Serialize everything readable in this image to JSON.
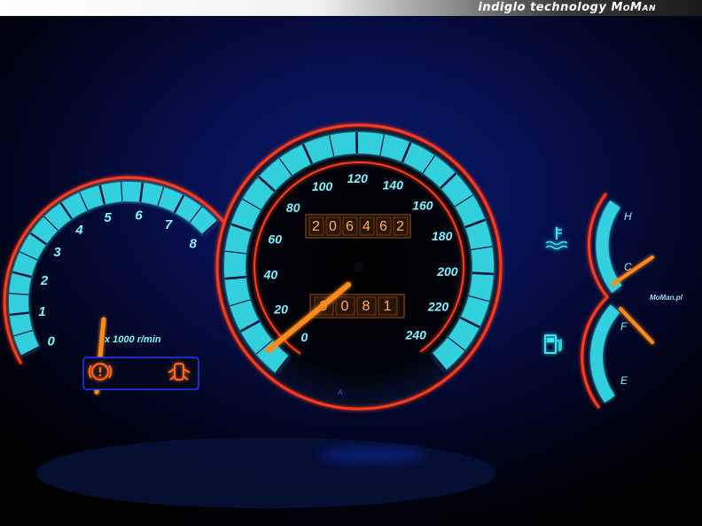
{
  "banner": {
    "tagline": "indiglo technology",
    "brand": "MoMan"
  },
  "colors": {
    "glow_cyan": "#39e6f2",
    "glow_blue": "#1a3cff",
    "ring_red": "#ff3a1a",
    "needle_orange": "#ff8a1e",
    "odo_amber": "#ffb060"
  },
  "tachometer": {
    "labels": [
      "0",
      "1",
      "2",
      "3",
      "4",
      "5",
      "6",
      "7",
      "8"
    ],
    "unit": "x 1000 r/min",
    "needle_value": 0
  },
  "speedometer": {
    "labels": [
      "0",
      "20",
      "40",
      "60",
      "80",
      "100",
      "120",
      "140",
      "160",
      "180",
      "200",
      "220",
      "240"
    ],
    "needle_value": 8,
    "odometer": "206462",
    "tripmeter": "0081"
  },
  "temperature": {
    "labels": [
      "H",
      "C"
    ],
    "icon": "coolant-temperature-icon"
  },
  "fuel": {
    "labels": [
      "F",
      "E"
    ],
    "icon": "fuel-pump-icon"
  },
  "watermark": "MoMan.pl",
  "warning_lights": [
    "brake-warning-icon",
    "door-ajar-icon"
  ]
}
